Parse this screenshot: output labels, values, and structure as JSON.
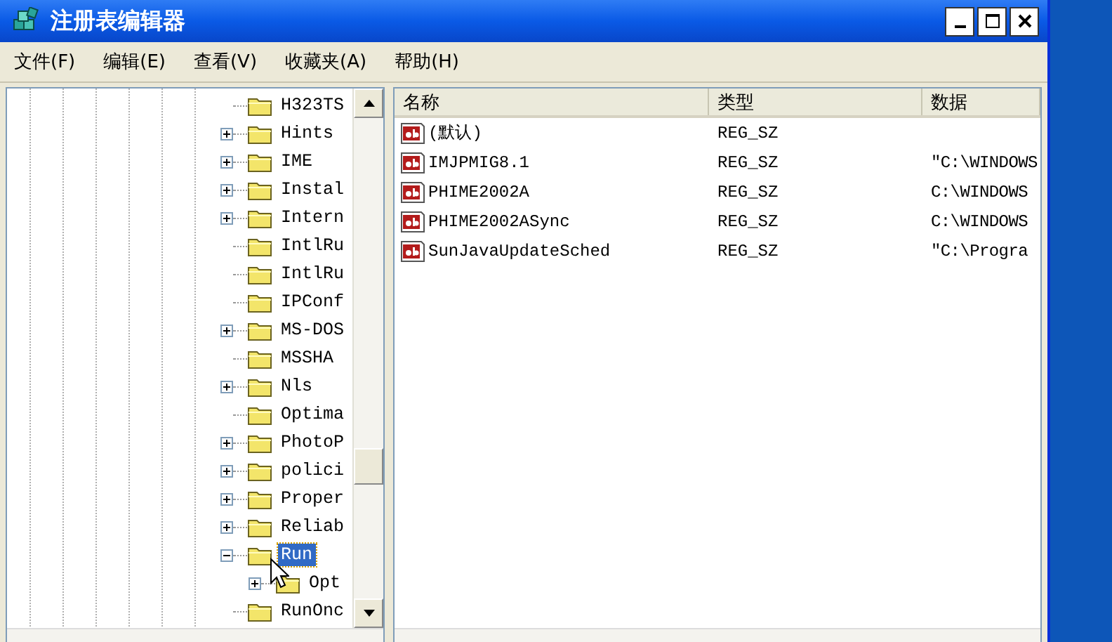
{
  "window": {
    "title": "注册表编辑器"
  },
  "menu": [
    "文件(F)",
    "编辑(E)",
    "查看(V)",
    "收藏夹(A)",
    "帮助(H)"
  ],
  "tree": {
    "items": [
      {
        "label": "H323TS",
        "selected": false
      },
      {
        "label": "Hints",
        "expanded": false,
        "selected": false
      },
      {
        "label": "IME",
        "expanded": false,
        "selected": false
      },
      {
        "label": "Instal",
        "expanded": false,
        "selected": false
      },
      {
        "label": "Intern",
        "expanded": false,
        "selected": false
      },
      {
        "label": "IntlRu",
        "selected": false
      },
      {
        "label": "IntlRu",
        "selected": false
      },
      {
        "label": "IPConf",
        "selected": false
      },
      {
        "label": "MS-DOS",
        "expanded": false,
        "selected": false
      },
      {
        "label": "MSSHA",
        "selected": false
      },
      {
        "label": "Nls",
        "expanded": false,
        "selected": false
      },
      {
        "label": "Optima",
        "selected": false
      },
      {
        "label": "PhotoP",
        "expanded": false,
        "selected": false
      },
      {
        "label": "polici",
        "expanded": false,
        "selected": false
      },
      {
        "label": "Proper",
        "expanded": false,
        "selected": false
      },
      {
        "label": "Reliab",
        "expanded": false,
        "selected": false
      },
      {
        "label": "Run",
        "expanded": true,
        "selected": true,
        "children": [
          {
            "label": "Opt",
            "expanded": false,
            "selected": false
          }
        ]
      },
      {
        "label": "RunOnc",
        "selected": false
      }
    ]
  },
  "table": {
    "columns": [
      "名称",
      "类型",
      "数据"
    ],
    "rows": [
      [
        "(默认)",
        "REG_SZ",
        ""
      ],
      [
        "IMJPMIG8.1",
        "REG_SZ",
        "\"C:\\WINDOWS"
      ],
      [
        "PHIME2002A",
        "REG_SZ",
        "C:\\WINDOWS"
      ],
      [
        "PHIME2002ASync",
        "REG_SZ",
        "C:\\WINDOWS"
      ],
      [
        "SunJavaUpdateSched",
        "REG_SZ",
        "\"C:\\Progra"
      ]
    ]
  }
}
